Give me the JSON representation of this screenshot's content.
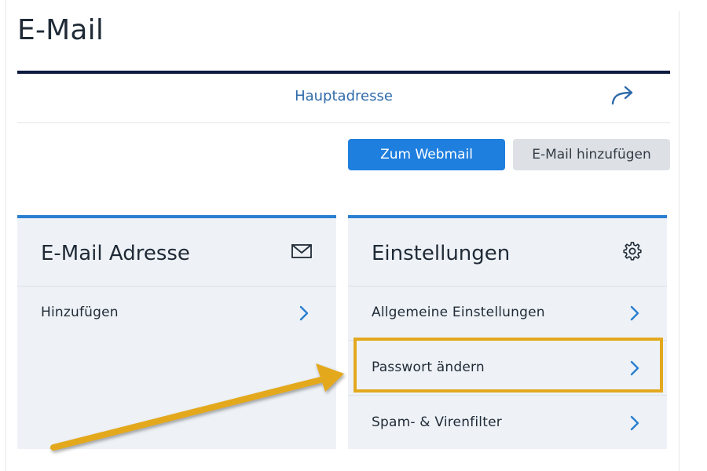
{
  "page": {
    "title": "E-Mail"
  },
  "main_address": {
    "label": "Hauptadresse",
    "icon": "share-arrow-icon"
  },
  "actions": {
    "webmail_label": "Zum Webmail",
    "add_email_label": "E-Mail hinzufügen"
  },
  "colors": {
    "primary_button": "#1f7fdf",
    "secondary_button": "#dde1e6",
    "card_accent": "#2a7fd0",
    "title_rule": "#0c1a3f",
    "highlight": "#e3a81e",
    "link": "#2f6bab"
  },
  "cards": {
    "email_address": {
      "title": "E-Mail Adresse",
      "icon": "envelope-icon",
      "rows": [
        {
          "label": "Hinzufügen"
        }
      ]
    },
    "settings": {
      "title": "Einstellungen",
      "icon": "gear-icon",
      "rows": [
        {
          "label": "Allgemeine Einstellungen"
        },
        {
          "label": "Passwort ändern",
          "highlighted": true
        },
        {
          "label": "Spam- & Virenfilter"
        }
      ]
    }
  }
}
